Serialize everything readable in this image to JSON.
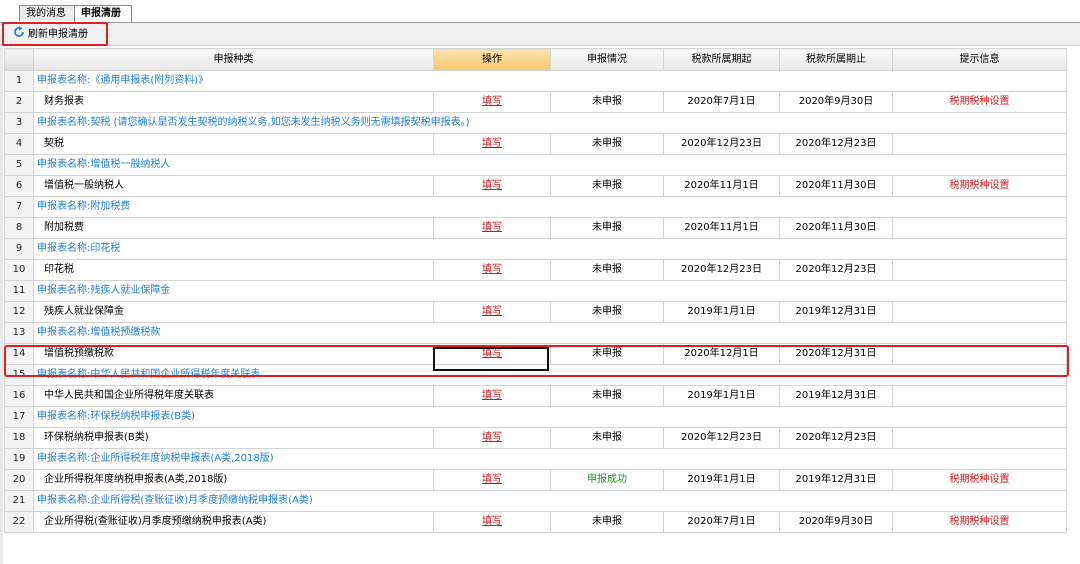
{
  "tabs": [
    {
      "label": "我的消息"
    },
    {
      "label": "申报清册"
    }
  ],
  "toolbar": {
    "refresh_label": "刷新申报清册"
  },
  "columns": [
    "申报种类",
    "操作",
    "申报情况",
    "税款所属期起",
    "税款所属期止",
    "提示信息"
  ],
  "rows": [
    {
      "num": "1",
      "type": "header",
      "text": "申报表名称:《通用申报表(附列资料)》"
    },
    {
      "num": "2",
      "type": "item",
      "name": "财务报表",
      "action": "填写",
      "status": "未申报",
      "start": "2020年7月1日",
      "end": "2020年9月30日",
      "tip": "税期税种设置"
    },
    {
      "num": "3",
      "type": "header",
      "text": "申报表名称:契税 (请您确认是否发生契税的纳税义务,如您未发生纳税义务则无需填报契税申报表。)"
    },
    {
      "num": "4",
      "type": "item",
      "name": "契税",
      "action": "填写",
      "status": "未申报",
      "start": "2020年12月23日",
      "end": "2020年12月23日",
      "tip": ""
    },
    {
      "num": "5",
      "type": "header",
      "text": "申报表名称:增值税一般纳税人"
    },
    {
      "num": "6",
      "type": "item",
      "name": "增值税一般纳税人",
      "action": "填写",
      "status": "未申报",
      "start": "2020年11月1日",
      "end": "2020年11月30日",
      "tip": "税期税种设置"
    },
    {
      "num": "7",
      "type": "header",
      "text": "申报表名称:附加税费"
    },
    {
      "num": "8",
      "type": "item",
      "name": "附加税费",
      "action": "填写",
      "status": "未申报",
      "start": "2020年11月1日",
      "end": "2020年11月30日",
      "tip": ""
    },
    {
      "num": "9",
      "type": "header",
      "text": "申报表名称:印花税"
    },
    {
      "num": "10",
      "type": "item",
      "name": "印花税",
      "action": "填写",
      "status": "未申报",
      "start": "2020年12月23日",
      "end": "2020年12月23日",
      "tip": ""
    },
    {
      "num": "11",
      "type": "header",
      "text": "申报表名称:残疾人就业保障金"
    },
    {
      "num": "12",
      "type": "item",
      "name": "残疾人就业保障金",
      "action": "填写",
      "status": "未申报",
      "start": "2019年1月1日",
      "end": "2019年12月31日",
      "tip": ""
    },
    {
      "num": "13",
      "type": "header",
      "text": "申报表名称:增值税预缴税款"
    },
    {
      "num": "14",
      "type": "item",
      "name": "增值税预缴税款",
      "action": "填写",
      "status": "未申报",
      "start": "2020年12月1日",
      "end": "2020年12月31日",
      "tip": "",
      "selected": true
    },
    {
      "num": "15",
      "type": "header",
      "text": "申报表名称:中华人民共和国企业所得税年度关联表"
    },
    {
      "num": "16",
      "type": "item",
      "name": "中华人民共和国企业所得税年度关联表",
      "action": "填写",
      "status": "未申报",
      "start": "2019年1月1日",
      "end": "2019年12月31日",
      "tip": ""
    },
    {
      "num": "17",
      "type": "header",
      "text": "申报表名称:环保税纳税申报表(B类)"
    },
    {
      "num": "18",
      "type": "item",
      "name": "环保税纳税申报表(B类)",
      "action": "填写",
      "status": "未申报",
      "start": "2020年12月23日",
      "end": "2020年12月23日",
      "tip": ""
    },
    {
      "num": "19",
      "type": "header",
      "text": "申报表名称:企业所得税年度纳税申报表(A类,2018版)"
    },
    {
      "num": "20",
      "type": "item",
      "name": "企业所得税年度纳税申报表(A类,2018版)",
      "action": "填写",
      "status": "申报成功",
      "start": "2019年1月1日",
      "end": "2019年12月31日",
      "tip": "税期税种设置"
    },
    {
      "num": "21",
      "type": "header",
      "text": "申报表名称:企业所得税(查账征收)月季度预缴纳税申报表(A类)"
    },
    {
      "num": "22",
      "type": "item",
      "name": "企业所得税(查账征收)月季度预缴纳税申报表(A类)",
      "action": "填写",
      "status": "未申报",
      "start": "2020年7月1日",
      "end": "2020年9月30日",
      "tip": "税期税种设置"
    }
  ],
  "colors": {
    "accent_red": "#e02020",
    "header_blue": "#1f7fd8",
    "success_green": "#1a9a1a",
    "op_header": "#f6c56e"
  }
}
